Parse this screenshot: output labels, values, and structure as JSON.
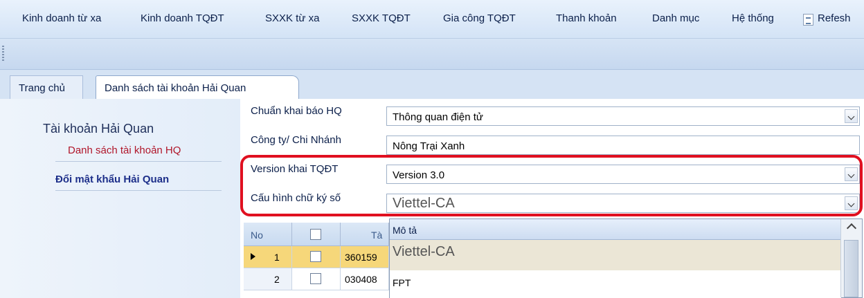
{
  "menu": {
    "items": [
      "Kinh doanh từ xa",
      "Kinh doanh TQĐT",
      "SXXK từ xa",
      "SXXK TQĐT",
      "Gia công TQĐT",
      "Thanh khoản",
      "Danh mục",
      "Hệ thống"
    ],
    "refresh_label": "Refesh"
  },
  "tabs": [
    "Trang chủ",
    "Danh sách tài khoản Hải Quan"
  ],
  "sidebar": {
    "title": "Tài khoản Hải Quan",
    "link_list": "Danh sách tài khoản HQ",
    "link_change_password": "Đổi mật khẩu Hải Quan"
  },
  "form": {
    "declare_standard_label": "Chuẩn khai báo HQ",
    "declare_standard_value": "Thông quan điện tử",
    "company_label": "Công ty/ Chi Nhánh",
    "company_value": "Nông Trại Xanh",
    "version_label": "Version khai TQĐT",
    "version_value": "Version 3.0",
    "signature_label": "Cấu hình chữ ký số",
    "signature_value": "Viettel-CA"
  },
  "grid": {
    "headers": [
      "No",
      "",
      "Tà"
    ],
    "rows": [
      {
        "no": "1",
        "code": "360159"
      },
      {
        "no": "2",
        "code": "030408"
      }
    ]
  },
  "dropdown": {
    "header": "Mô tả",
    "options": [
      "Viettel-CA",
      "FPT"
    ]
  },
  "colors": {
    "highlight": "#e01020",
    "selected_row": "#f6d77a"
  }
}
